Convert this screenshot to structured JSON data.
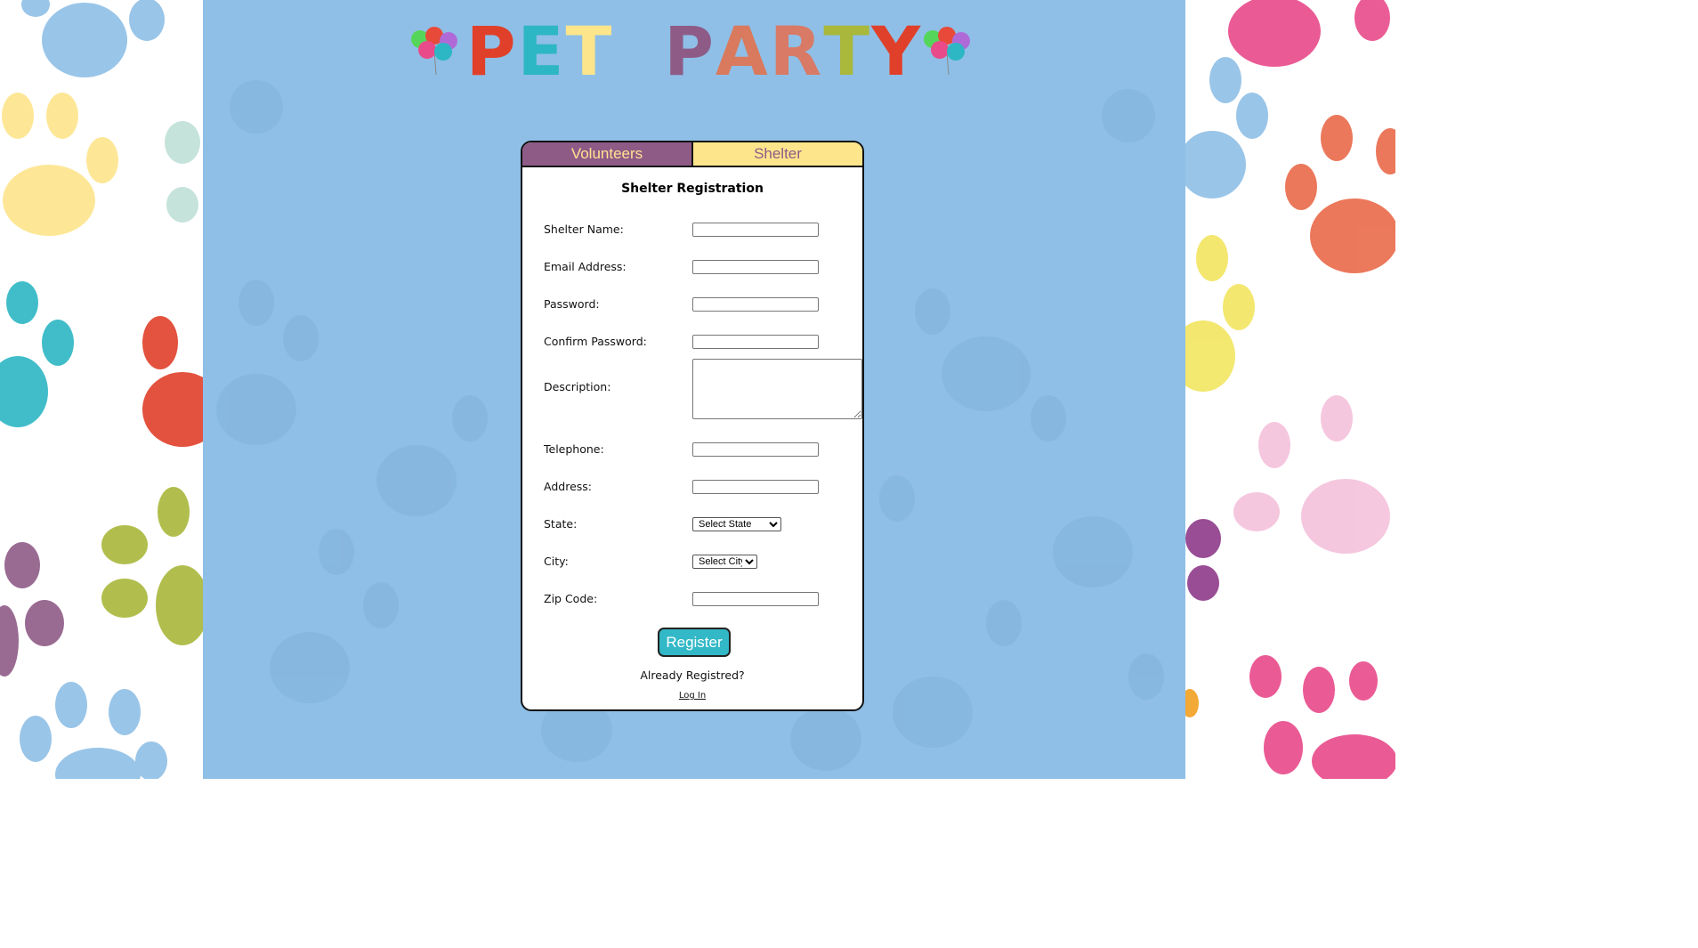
{
  "logo": {
    "letters": [
      {
        "ch": "P",
        "color": "#e0402a"
      },
      {
        "ch": "E",
        "color": "#2db6c4"
      },
      {
        "ch": "T",
        "color": "#fde58c"
      },
      {
        "ch": " ",
        "color": "#000000"
      },
      {
        "ch": " ",
        "color": "#000000"
      },
      {
        "ch": "P",
        "color": "#8e5b87"
      },
      {
        "ch": "A",
        "color": "#d97a5e"
      },
      {
        "ch": "R",
        "color": "#d87a66"
      },
      {
        "ch": "T",
        "color": "#a9b83a"
      },
      {
        "ch": "Y",
        "color": "#e0402a"
      }
    ]
  },
  "tabs": {
    "volunteers": "Volunteers",
    "shelter": "Shelter"
  },
  "form": {
    "title": "Shelter Registration",
    "fields": {
      "shelter_name": "Shelter Name:",
      "email": "Email Address:",
      "password": "Password:",
      "confirm_password": "Confirm Password:",
      "description": "Description:",
      "telephone": "Telephone:",
      "address": "Address:",
      "state": "State:",
      "city": "City:",
      "zip": "Zip Code:"
    },
    "state_selected": "Select State",
    "city_selected": "Select City",
    "register_label": "Register",
    "already_text": "Already Registred?",
    "login_label": "Log In"
  },
  "colors": {
    "center_bg": "#8fbfe6",
    "tab_volunteers": "#8e5b87",
    "tab_shelter": "#fde58c",
    "register_button": "#32b8c6"
  },
  "icons": [
    "balloons-icon",
    "paw-print-pattern"
  ]
}
